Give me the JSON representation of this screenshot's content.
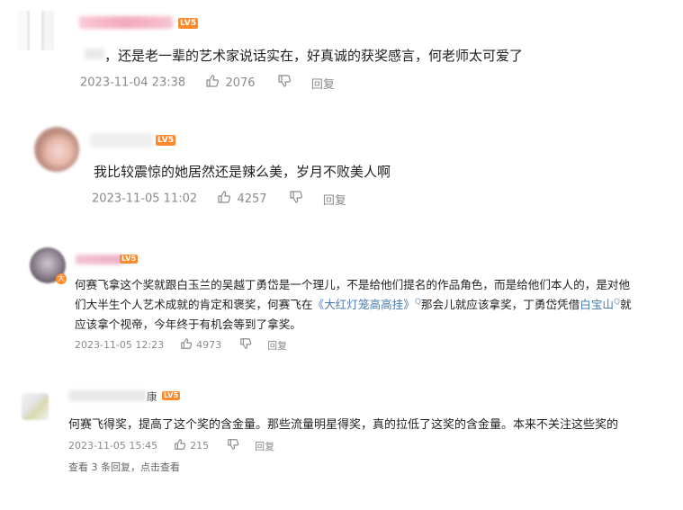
{
  "comments": [
    {
      "badge": "LV5",
      "text": "，还是老一辈的艺术家说话实在，好真诚的获奖感言，何老师太可爱了",
      "time": "2023-11-04 23:38",
      "likes": "2076",
      "reply_label": "回复"
    },
    {
      "badge": "LV5",
      "text": "我比较震惊的她居然还是辣么美，岁月不败美人啊",
      "time": "2023-11-05 11:02",
      "likes": "4257",
      "reply_label": "回复"
    },
    {
      "badge": "LV5",
      "avatar_badge": "大",
      "line1": "何赛飞拿这个奖就跟白玉兰的吴越丁勇岱是一个理儿，不是给他们提名的作品角色，而是给他们本人的，是对他",
      "line2_a": "们大半生个人艺术成就的肯定和褒奖，何赛飞在",
      "line2_link1": "《大红灯笼高高挂》",
      "line2_sup1": "Q",
      "line2_b": "那会儿就应该拿奖，丁勇岱凭借",
      "line2_link2": "白宝山",
      "line2_sup2": "Q",
      "line2_c": "就",
      "line3": "应该拿个视帝，今年终于有机会等到了拿奖。",
      "time": "2023-11-05 12:23",
      "likes": "4973",
      "reply_label": "回复"
    },
    {
      "badge": "LV5",
      "name_suffix": "康",
      "text": "何赛飞得奖，提高了这个奖的含金量。那些流量明星得奖，真的拉低了这奖的含金量。本来不关注这些奖的",
      "time": "2023-11-05 15:45",
      "likes": "215",
      "reply_label": "回复",
      "view_replies": "查看 3 条回复，点击查看"
    }
  ],
  "colors": {
    "badge": "#ff8a2c",
    "meta_text": "#8a8a8a",
    "link": "#4a7bb0"
  },
  "icons": [
    "thumbs-up-icon",
    "thumbs-down-icon"
  ]
}
